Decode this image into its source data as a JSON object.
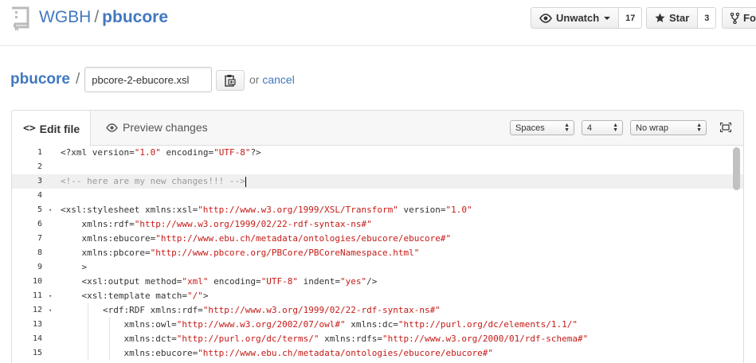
{
  "repo": {
    "owner": "WGBH",
    "separator": "/",
    "name": "pbucore"
  },
  "actions": {
    "watch": {
      "label": "Unwatch",
      "count": "17"
    },
    "star": {
      "label": "Star",
      "count": "3"
    },
    "fork": {
      "label": "Fo"
    }
  },
  "breadcrumb": {
    "root": "pbucore",
    "separator": "/",
    "filename": "pbcore-2-ebucore.xsl"
  },
  "or_text": "or",
  "cancel_label": "cancel",
  "editor": {
    "tabs": {
      "edit": "Edit file",
      "edit_icon": "<>",
      "preview": "Preview changes"
    },
    "indent_mode": "Spaces",
    "indent_size": "4",
    "wrap_mode": "No wrap"
  },
  "code_lines": [
    {
      "num": "1",
      "fold": "",
      "text": "<?xml version=\"1.0\" encoding=\"UTF-8\"?>"
    },
    {
      "num": "2",
      "fold": "",
      "text": ""
    },
    {
      "num": "3",
      "fold": "",
      "text": "<!-- here are my new changes!!! -->"
    },
    {
      "num": "4",
      "fold": "",
      "text": ""
    },
    {
      "num": "5",
      "fold": "▾",
      "text": "<xsl:stylesheet xmlns:xsl=\"http://www.w3.org/1999/XSL/Transform\" version=\"1.0\""
    },
    {
      "num": "6",
      "fold": "",
      "text": "    xmlns:rdf=\"http://www.w3.org/1999/02/22-rdf-syntax-ns#\""
    },
    {
      "num": "7",
      "fold": "",
      "text": "    xmlns:ebucore=\"http://www.ebu.ch/metadata/ontologies/ebucore/ebucore#\""
    },
    {
      "num": "8",
      "fold": "",
      "text": "    xmlns:pbcore=\"http://www.pbcore.org/PBCore/PBCoreNamespace.html\""
    },
    {
      "num": "9",
      "fold": "",
      "text": "    >"
    },
    {
      "num": "10",
      "fold": "",
      "text": "    <xsl:output method=\"xml\" encoding=\"UTF-8\" indent=\"yes\"/>"
    },
    {
      "num": "11",
      "fold": "▾",
      "text": "    <xsl:template match=\"/\">"
    },
    {
      "num": "12",
      "fold": "▾",
      "text": "        <rdf:RDF xmlns:rdf=\"http://www.w3.org/1999/02/22-rdf-syntax-ns#\""
    },
    {
      "num": "13",
      "fold": "",
      "text": "            xmlns:owl=\"http://www.w3.org/2002/07/owl#\" xmlns:dc=\"http://purl.org/dc/elements/1.1/\""
    },
    {
      "num": "14",
      "fold": "",
      "text": "            xmlns:dct=\"http://purl.org/dc/terms/\" xmlns:rdfs=\"http://www.w3.org/2000/01/rdf-schema#\""
    },
    {
      "num": "15",
      "fold": "",
      "text": "            xmlns:ebucore=\"http://www.ebu.ch/metadata/ontologies/ebucore/ebucore#\""
    }
  ],
  "active_line": 3,
  "colors": {
    "link": "#4078c0",
    "string": "#c41a16",
    "comment": "#999999"
  }
}
